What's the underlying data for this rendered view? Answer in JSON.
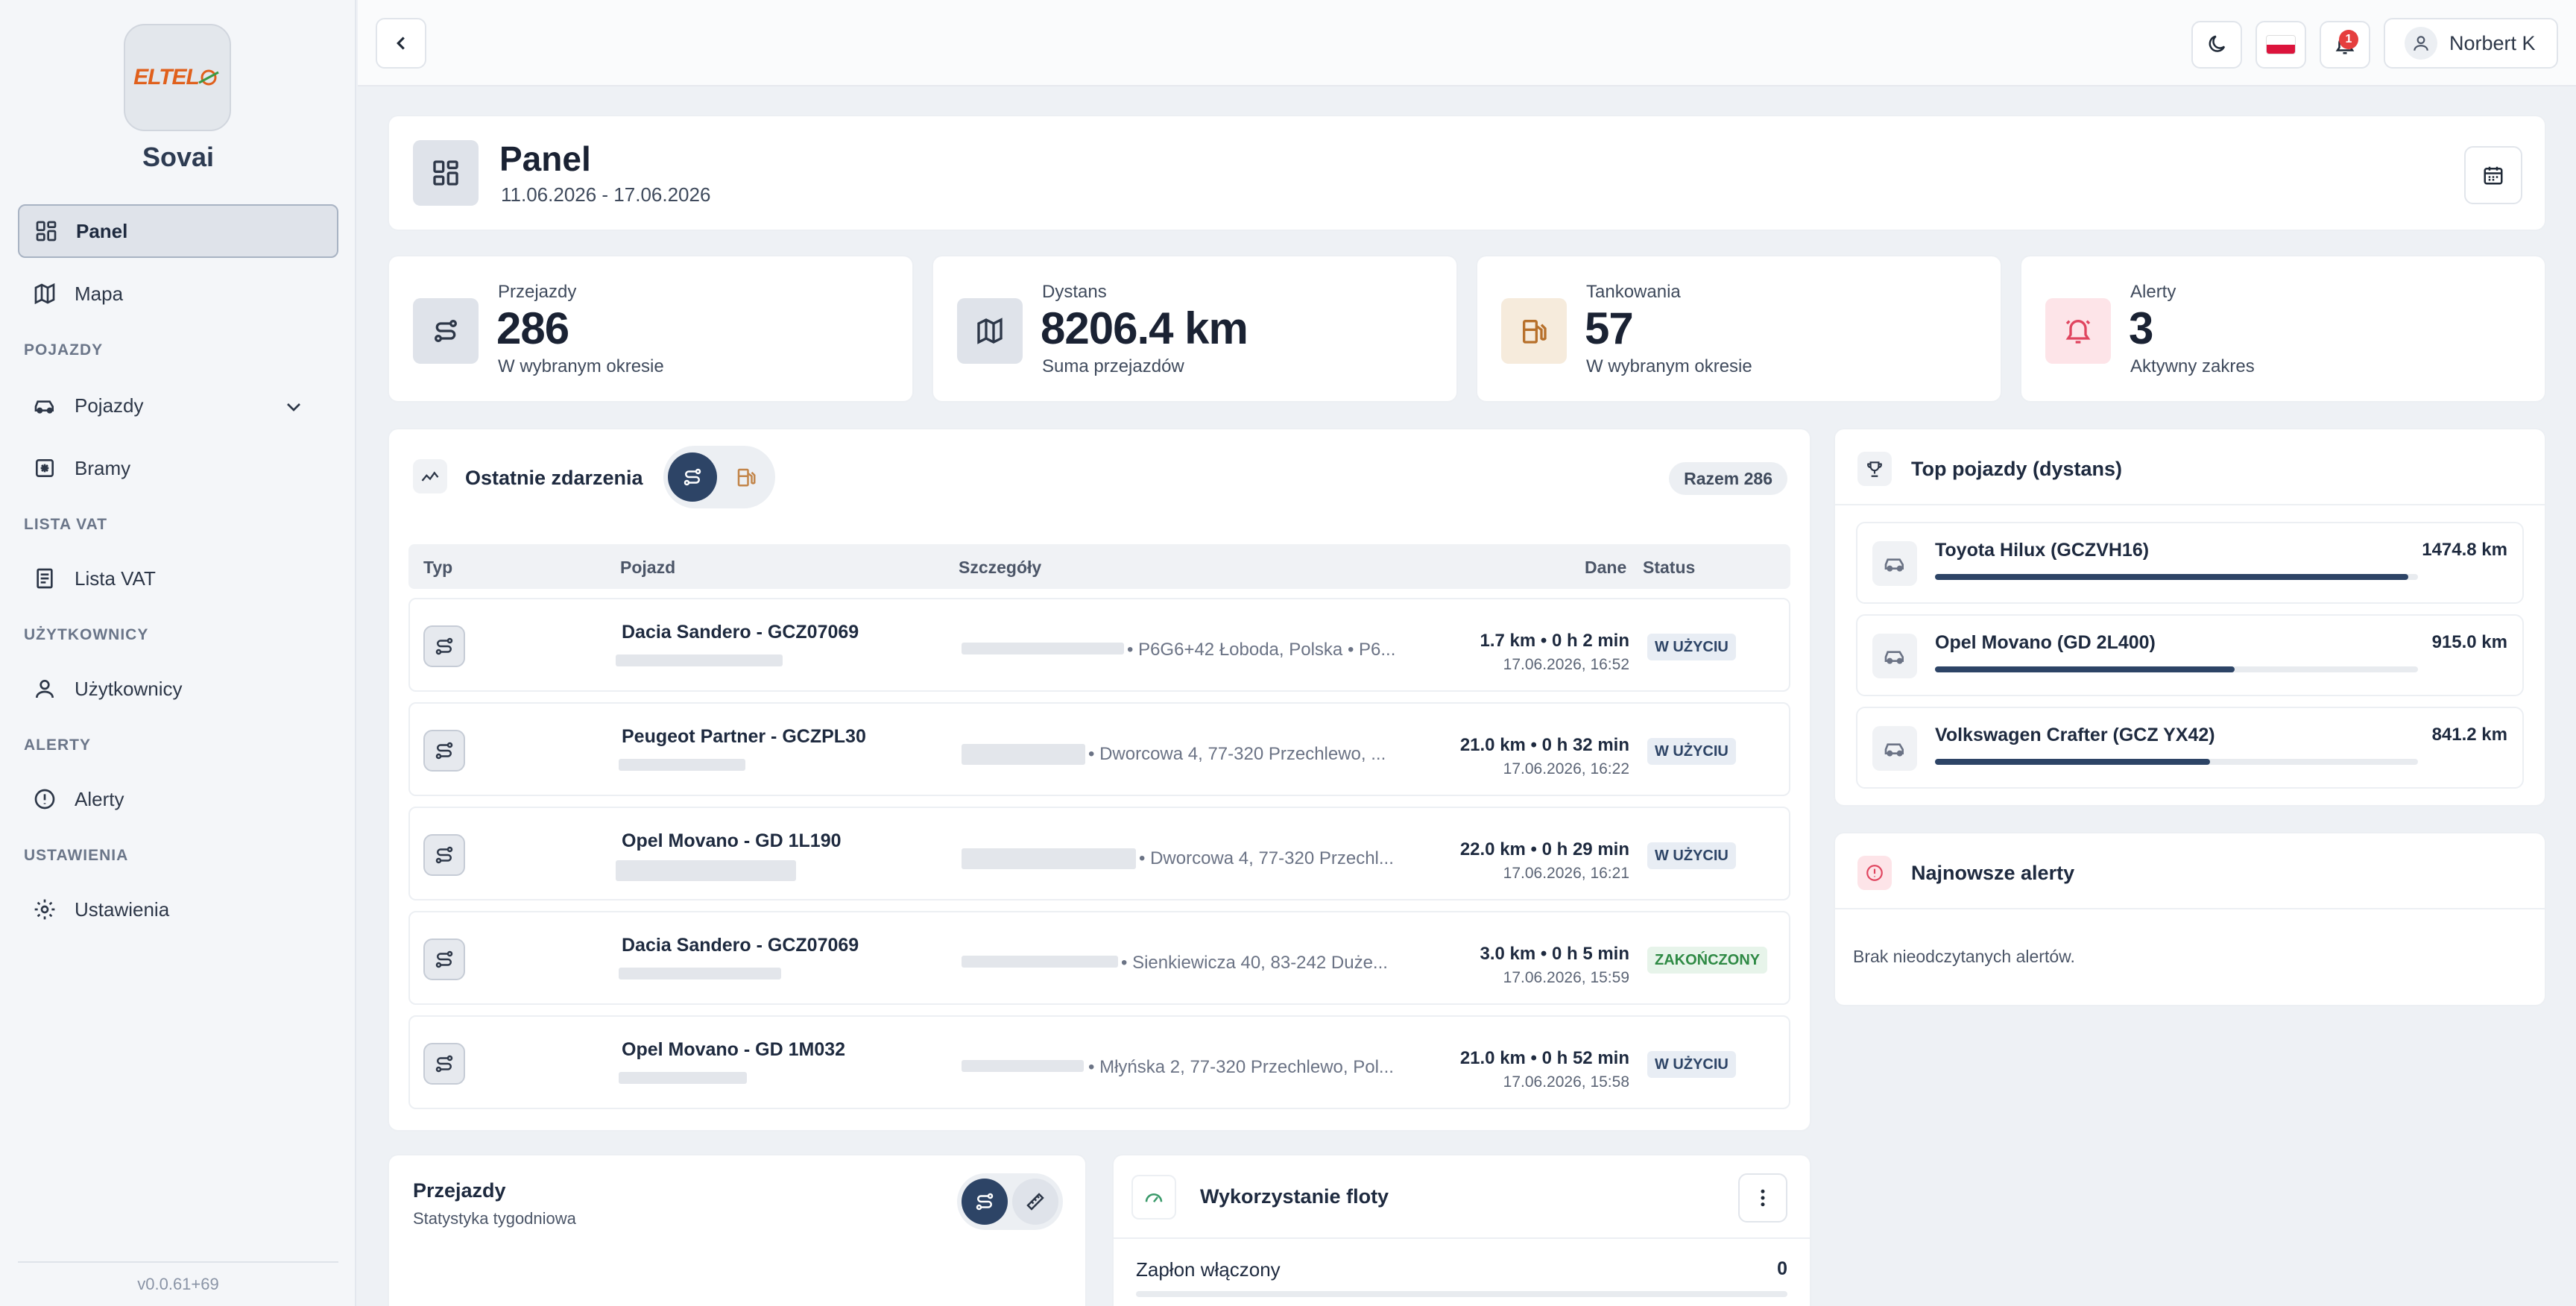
{
  "app": {
    "name": "Sovai",
    "logo_text": "ELTEL",
    "version": "v0.0.61+69"
  },
  "sidebar": {
    "items": [
      {
        "label": "Panel",
        "icon": "dashboard-icon",
        "active": true
      },
      {
        "label": "Mapa",
        "icon": "map-icon"
      },
      {
        "label": "Pojazdy",
        "icon": "car-icon",
        "expandable": true
      },
      {
        "label": "Bramy",
        "icon": "gate-icon"
      },
      {
        "label": "Lista VAT",
        "icon": "document-icon"
      },
      {
        "label": "Użytkownicy",
        "icon": "user-icon"
      },
      {
        "label": "Alerty",
        "icon": "alert-circle-icon"
      },
      {
        "label": "Ustawienia",
        "icon": "gear-icon"
      }
    ],
    "sections": [
      "POJAZDY",
      "LISTA VAT",
      "UŻYTKOWNICY",
      "ALERTY",
      "USTAWIENIA"
    ]
  },
  "topbar": {
    "user_name": "Norbert K",
    "notification_count": "1",
    "language_flag": "flag-pl-icon"
  },
  "header": {
    "title": "Panel",
    "date_range": "11.06.2026 - 17.06.2026"
  },
  "stats": [
    {
      "label": "Przejazdy",
      "value": "286",
      "sub": "W wybranym okresie",
      "icon": "route-icon",
      "color": "#dfe3ea"
    },
    {
      "label": "Dystans",
      "value": "8206.4 km",
      "sub": "Suma przejazdów",
      "icon": "map-icon",
      "color": "#dfe3ea"
    },
    {
      "label": "Tankowania",
      "value": "57",
      "sub": "W wybranym okresie",
      "icon": "fuel-icon",
      "color": "#f6ebdc"
    },
    {
      "label": "Alerty",
      "value": "3",
      "sub": "Aktywny zakres",
      "icon": "bell-icon",
      "color": "#fde4e8"
    }
  ],
  "events": {
    "title": "Ostatnie zdarzenia",
    "total": "Razem 286",
    "columns": [
      "Typ",
      "Pojazd",
      "Szczegóły",
      "Dane",
      "Status"
    ],
    "rows": [
      {
        "vehicle": "Dacia Sandero - GCZ07069",
        "details": "• P6G6+42 Łoboda, Polska • P6...",
        "data1": "1.7 km • 0 h 2 min",
        "data2": "17.06.2026, 16:52",
        "status": "W UŻYCIU"
      },
      {
        "vehicle": "Peugeot Partner - GCZPL30",
        "details": "• Dworcowa 4, 77-320 Przechlewo, ...",
        "data1": "21.0 km • 0 h 32 min",
        "data2": "17.06.2026, 16:22",
        "status": "W UŻYCIU"
      },
      {
        "vehicle": "Opel Movano - GD 1L190",
        "details": "• Dworcowa 4, 77-320 Przechl...",
        "data1": "22.0 km • 0 h 29 min",
        "data2": "17.06.2026, 16:21",
        "status": "W UŻYCIU"
      },
      {
        "vehicle": "Dacia Sandero - GCZ07069",
        "details": "• Sienkiewicza 40, 83-242 Duże...",
        "data1": "3.0 km • 0 h 5 min",
        "data2": "17.06.2026, 15:59",
        "status": "ZAKOŃCZONY"
      },
      {
        "vehicle": "Opel Movano - GD 1M032",
        "details": "• Młyńska 2, 77-320 Przechlewo, Pol...",
        "data1": "21.0 km • 0 h 52 min",
        "data2": "17.06.2026, 15:58",
        "status": "W UŻYCIU"
      }
    ]
  },
  "top_vehicles": {
    "title": "Top pojazdy (dystans)",
    "items": [
      {
        "name": "Toyota Hilux (GCZVH16)",
        "km": "1474.8 km",
        "fraction": 0.98
      },
      {
        "name": "Opel Movano (GD 2L400)",
        "km": "915.0 km",
        "fraction": 0.62
      },
      {
        "name": "Volkswagen Crafter (GCZ YX42)",
        "km": "841.2 km",
        "fraction": 0.57
      }
    ]
  },
  "alerts": {
    "title": "Najnowsze alerty",
    "empty": "Brak nieodczytanych alertów."
  },
  "trips_chart": {
    "title": "Przejazdy",
    "subtitle": "Statystyka tygodniowa"
  },
  "fleet": {
    "title": "Wykorzystanie floty",
    "row_label": "Zapłon włączony",
    "row_value": "0"
  },
  "colors": {
    "accent": "#2d4466",
    "status_active_bg": "#e8edf4",
    "status_done": "#2f8a45"
  }
}
